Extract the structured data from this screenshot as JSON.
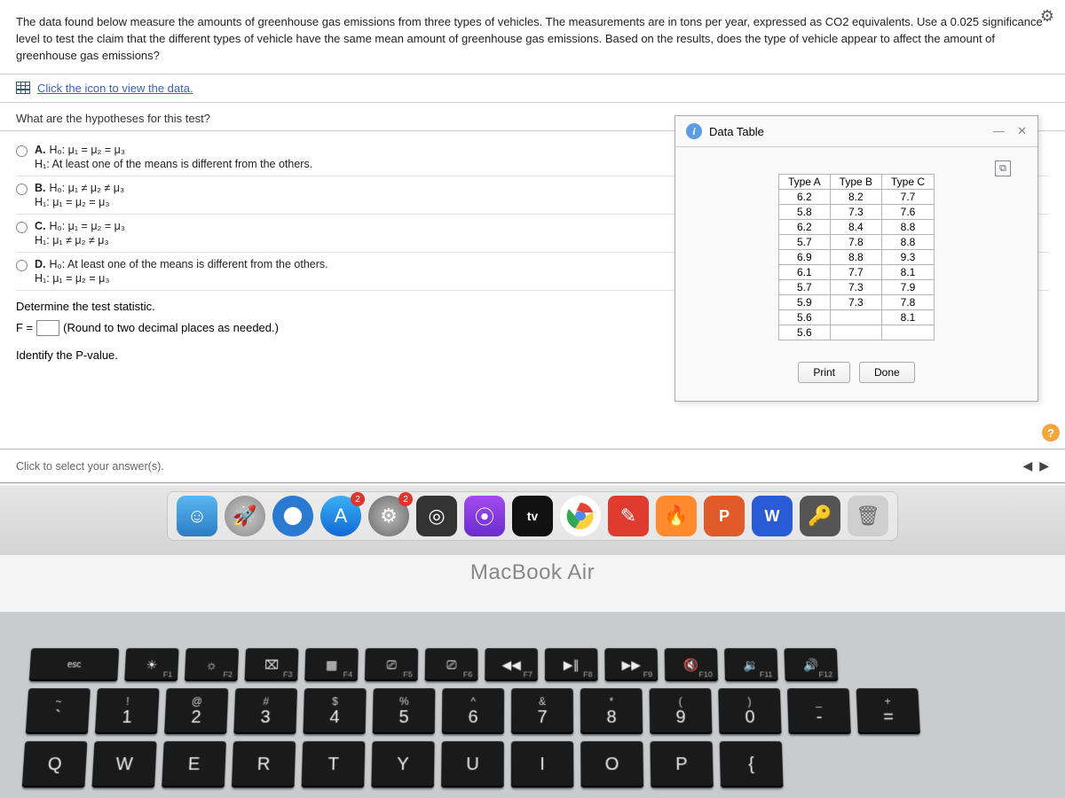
{
  "question": {
    "intro": "The data found below measure the amounts of greenhouse gas emissions from three types of vehicles. The measurements are in tons per year, expressed as CO2 equivalents. Use a 0.025 significance level to test the claim that the different types of vehicle have the same mean amount of greenhouse gas emissions. Based on the results, does the type of vehicle appear to affect the amount of greenhouse gas emissions?",
    "data_link": "Click the icon to view the data.",
    "hyp_prompt": "What are the hypotheses for this test?"
  },
  "options": {
    "A": {
      "letter": "A.",
      "h0": "H₀: μ₁ = μ₂ = μ₃",
      "h1": "H₁: At least one of the means is different from the others."
    },
    "B": {
      "letter": "B.",
      "h0": "H₀: μ₁ ≠ μ₂ ≠ μ₃",
      "h1": "H₁: μ₁ = μ₂ = μ₃"
    },
    "C": {
      "letter": "C.",
      "h0": "H₀: μ₁ = μ₂ = μ₃",
      "h1": "H₁: μ₁ ≠ μ₂ ≠ μ₃"
    },
    "D": {
      "letter": "D.",
      "h0": "H₀: At least one of the means is different from the others.",
      "h1": "H₁: μ₁ = μ₂ = μ₃"
    }
  },
  "stat": {
    "determine": "Determine the test statistic.",
    "f_prefix": "F =",
    "f_note": "(Round to two decimal places as needed.)",
    "pvalue": "Identify the P-value."
  },
  "footer": {
    "select": "Click to select your answer(s)."
  },
  "modal": {
    "title": "Data Table",
    "print": "Print",
    "done": "Done",
    "headers": [
      "Type A",
      "Type B",
      "Type C"
    ],
    "rows": [
      [
        "6.2",
        "8.2",
        "7.7"
      ],
      [
        "5.8",
        "7.3",
        "7.6"
      ],
      [
        "6.2",
        "8.4",
        "8.8"
      ],
      [
        "5.7",
        "7.8",
        "8.8"
      ],
      [
        "6.9",
        "8.8",
        "9.3"
      ],
      [
        "6.1",
        "7.7",
        "8.1"
      ],
      [
        "5.7",
        "7.3",
        "7.9"
      ],
      [
        "5.9",
        "7.3",
        "7.8"
      ],
      [
        "5.6",
        "",
        "8.1"
      ],
      [
        "5.6",
        "",
        ""
      ]
    ]
  },
  "dock": {
    "tv": "tv",
    "pp": "P",
    "word": "W",
    "badge_appstore": "2",
    "badge_settings": "2"
  },
  "macbook": "MacBook Air",
  "keys": {
    "esc": "esc",
    "frow": [
      {
        "g": "☀",
        "fn": "F1"
      },
      {
        "g": "☼",
        "fn": "F2"
      },
      {
        "g": "⌧",
        "fn": "F3"
      },
      {
        "g": "▦",
        "fn": "F4"
      },
      {
        "g": "⎚",
        "fn": "F5"
      },
      {
        "g": "⎚",
        "fn": "F6"
      },
      {
        "g": "◀◀",
        "fn": "F7"
      },
      {
        "g": "▶∥",
        "fn": "F8"
      },
      {
        "g": "▶▶",
        "fn": "F9"
      },
      {
        "g": "🔇",
        "fn": "F10"
      },
      {
        "g": "🔉",
        "fn": "F11"
      },
      {
        "g": "🔊",
        "fn": "F12"
      }
    ],
    "numrow": [
      {
        "t": "~",
        "m": "`"
      },
      {
        "t": "!",
        "m": "1"
      },
      {
        "t": "@",
        "m": "2"
      },
      {
        "t": "#",
        "m": "3"
      },
      {
        "t": "$",
        "m": "4"
      },
      {
        "t": "%",
        "m": "5"
      },
      {
        "t": "^",
        "m": "6"
      },
      {
        "t": "&",
        "m": "7"
      },
      {
        "t": "*",
        "m": "8"
      },
      {
        "t": "(",
        "m": "9"
      },
      {
        "t": ")",
        "m": "0"
      },
      {
        "t": "_",
        "m": "-"
      },
      {
        "t": "+",
        "m": "="
      }
    ],
    "qrow": [
      "Q",
      "W",
      "E",
      "R",
      "T",
      "Y",
      "U",
      "I",
      "O",
      "P",
      "{"
    ]
  }
}
